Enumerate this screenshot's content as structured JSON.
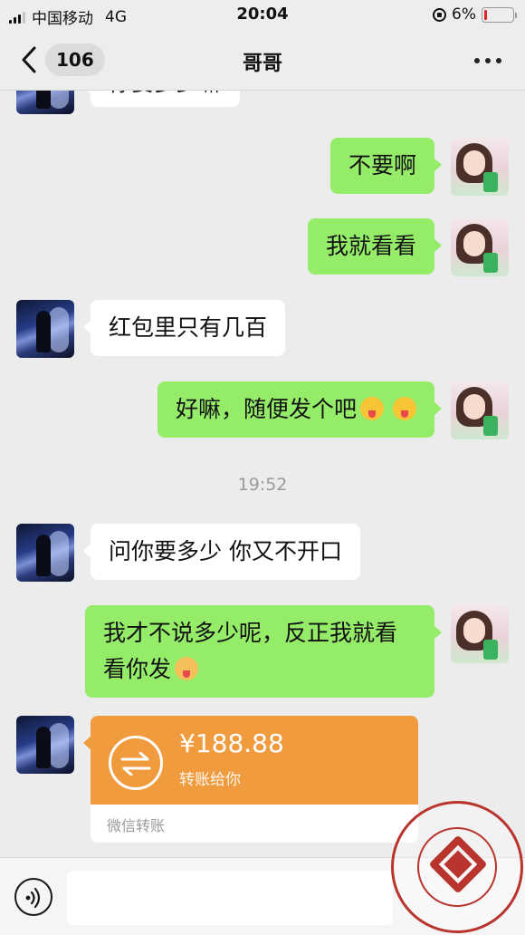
{
  "status_bar": {
    "carrier": "中国移动",
    "network": "4G",
    "time": "20:04",
    "battery": "6%",
    "battery_level": 0.06,
    "colors": {
      "battery_low": "#e0252b"
    }
  },
  "nav": {
    "back_badge": "106",
    "title": "哥哥"
  },
  "messages": [
    {
      "side": "in",
      "text": "你要多少嘛"
    },
    {
      "side": "out",
      "text": "不要啊"
    },
    {
      "side": "out",
      "text": "我就看看"
    },
    {
      "side": "in",
      "text": "红包里只有几百"
    },
    {
      "side": "out",
      "text": "好嘛，随便发个吧",
      "emoji": [
        "squinting-tongue-emoji",
        "squinting-tongue-emoji"
      ]
    },
    {
      "side": "in",
      "text": "问你要多少 你又不开口"
    },
    {
      "side": "out",
      "text_line1": "我才不说多少呢，反正我就看",
      "text_line2": "看你发",
      "emoji": [
        "thinking-emoji"
      ]
    }
  ],
  "timestamp": "19:52",
  "transfer": {
    "amount": "¥188.88",
    "note": "转账给你",
    "footer": "微信转账",
    "colors": {
      "card": "#f09b3e"
    }
  },
  "colors": {
    "background": "#ececec",
    "bubble_out": "#95ec69",
    "bubble_in": "#ffffff"
  }
}
